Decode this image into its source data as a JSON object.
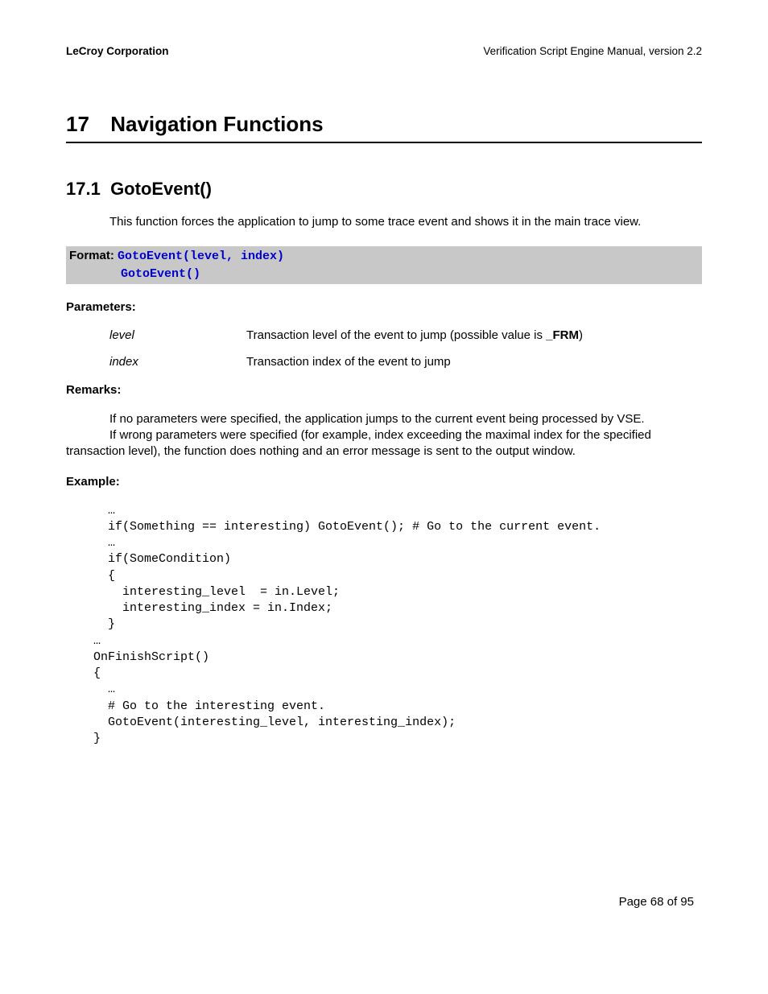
{
  "header": {
    "left": "LeCroy Corporation",
    "right": "Verification Script Engine Manual, version 2.2"
  },
  "chapter": {
    "number": "17",
    "title": "Navigation Functions"
  },
  "section": {
    "number": "17.1",
    "title": "GotoEvent()"
  },
  "intro": "This function forces the application to jump to some trace event and shows it in the main trace view.",
  "format": {
    "label": "Format: ",
    "line1": "GotoEvent(level, index)",
    "line2": "GotoEvent()"
  },
  "parameters_label": "Parameters:",
  "parameters": [
    {
      "name": "level",
      "desc_pre": "Transaction level of the event to jump (possible value is ",
      "desc_bold": "_FRM",
      "desc_post": ")"
    },
    {
      "name": "index",
      "desc_pre": "Transaction index of the event to jump",
      "desc_bold": "",
      "desc_post": ""
    }
  ],
  "remarks_label": "Remarks:",
  "remarks": {
    "para1a": "If no parameters were specified, the application jumps to the current event being processed by VSE.",
    "para1b": "If wrong parameters were specified (for example, index exceeding the maximal index for the specified",
    "hanging": "transaction level), the function does nothing and an error message is sent to the output window."
  },
  "example_label": "Example:",
  "code": "  …\n  if(Something == interesting) GotoEvent(); # Go to the current event.\n  …\n  if(SomeCondition)\n  {\n    interesting_level  = in.Level;\n    interesting_index = in.Index;\n  }\n…\nOnFinishScript()\n{\n  …\n  # Go to the interesting event.\n  GotoEvent(interesting_level, interesting_index);\n}",
  "footer": "Page 68 of 95"
}
